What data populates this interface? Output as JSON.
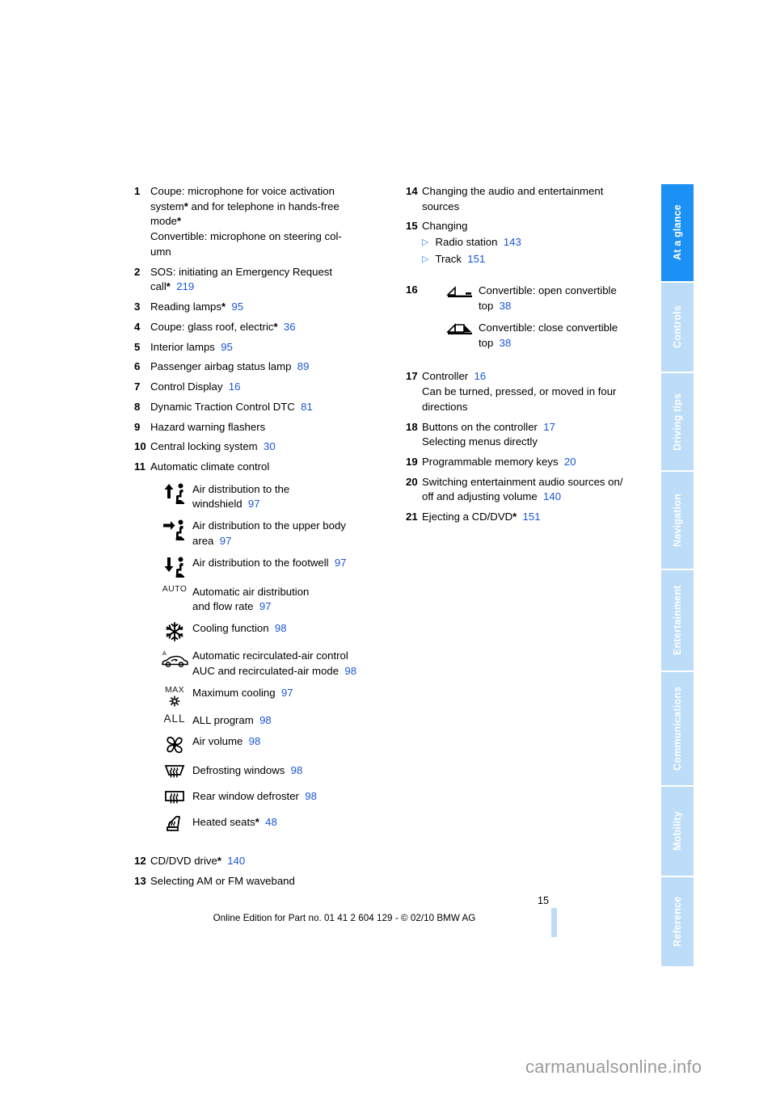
{
  "tabs": [
    {
      "label": "At a glance",
      "active": true
    },
    {
      "label": "Controls",
      "active": false
    },
    {
      "label": "Driving tips",
      "active": false
    },
    {
      "label": "Navigation",
      "active": false
    },
    {
      "label": "Entertainment",
      "active": false
    },
    {
      "label": "Communications",
      "active": false
    },
    {
      "label": "Mobility",
      "active": false
    },
    {
      "label": "Reference",
      "active": false
    }
  ],
  "colors": {
    "tab_active": "#1b90f5",
    "tab_inactive": "#bcdcf8",
    "page_link": "#1a56d6",
    "bullet": "#2f86f0"
  },
  "left": {
    "i1": {
      "num": "1",
      "l1": "Coupe: microphone for voice activation",
      "l2": "system",
      "l2b": " and for telephone in hands-free",
      "l3": "mode",
      "l4": "Convertible: microphone on steering col-",
      "l5": "umn"
    },
    "i2": {
      "num": "2",
      "l1": "SOS: initiating an Emergency Request",
      "l2": "call",
      "page": "219"
    },
    "i3": {
      "num": "3",
      "text": "Reading lamps",
      "page": "95"
    },
    "i4": {
      "num": "4",
      "text": "Coupe: glass roof, electric",
      "page": "36"
    },
    "i5": {
      "num": "5",
      "text": "Interior lamps",
      "page": "95"
    },
    "i6": {
      "num": "6",
      "text": "Passenger airbag status lamp",
      "page": "89"
    },
    "i7": {
      "num": "7",
      "text": "Control Display",
      "page": "16"
    },
    "i8": {
      "num": "8",
      "text": "Dynamic Traction Control DTC",
      "page": "81"
    },
    "i9": {
      "num": "9",
      "text": "Hazard warning flashers"
    },
    "i10": {
      "num": "10",
      "text": "Central locking system",
      "page": "30"
    },
    "i11": {
      "num": "11",
      "text": "Automatic climate control"
    },
    "i12": {
      "num": "12",
      "text": "CD/DVD drive",
      "page": "140"
    },
    "i13": {
      "num": "13",
      "text": "Selecting AM or FM waveband"
    }
  },
  "climate": [
    {
      "icon": "air-distribution-windshield-icon",
      "l1": "Air distribution to the",
      "l2": "windshield",
      "page": "97"
    },
    {
      "icon": "air-distribution-upper-body-icon",
      "l1": "Air distribution to the upper body",
      "l2": "area",
      "page": "97"
    },
    {
      "icon": "air-distribution-footwell-icon",
      "l1": "Air distribution to the footwell",
      "page": "97"
    },
    {
      "icon": "auto-icon",
      "icon_text": "AUTO",
      "l1": "Automatic air distribution",
      "l2": "and flow rate",
      "page": "97"
    },
    {
      "icon": "snowflake-cooling-icon",
      "l1": "Cooling function",
      "page": "98"
    },
    {
      "icon": "recirculated-air-car-icon",
      "l1": "Automatic recirculated-air control",
      "l2": "AUC and recirculated-air mode",
      "page": "98"
    },
    {
      "icon": "max-cooling-icon",
      "icon_text": "MAX",
      "l1": "Maximum cooling",
      "page": "97"
    },
    {
      "icon": "all-program-icon",
      "icon_text": "ALL",
      "l1": "ALL program",
      "page": "98"
    },
    {
      "icon": "fan-air-volume-icon",
      "l1": "Air volume",
      "page": "98"
    },
    {
      "icon": "windshield-defrost-icon",
      "l1": "Defrosting windows",
      "page": "98"
    },
    {
      "icon": "rear-window-defroster-icon",
      "l1": "Rear window defroster",
      "page": "98"
    },
    {
      "icon": "heated-seat-icon",
      "l1": "Heated seats",
      "asterisk": true,
      "page": "48"
    }
  ],
  "right": {
    "i14": {
      "num": "14",
      "l1": "Changing the audio and entertainment",
      "l2": "sources"
    },
    "i15": {
      "num": "15",
      "text": "Changing",
      "subs": [
        {
          "label": "Radio station",
          "page": "143"
        },
        {
          "label": "Track",
          "page": "151"
        }
      ]
    },
    "i16": {
      "num": "16",
      "icons": [
        {
          "icon": "convertible-top-open-icon",
          "l1": "Convertible: open convertible",
          "l2": "top",
          "page": "38"
        },
        {
          "icon": "convertible-top-close-icon",
          "l1": "Convertible: close convertible",
          "l2": "top",
          "page": "38"
        }
      ]
    },
    "i17": {
      "num": "17",
      "text": "Controller",
      "page": "16",
      "l2": "Can be turned, pressed, or moved in four",
      "l3": "directions"
    },
    "i18": {
      "num": "18",
      "text": "Buttons on the controller",
      "page": "17",
      "l2": "Selecting menus directly"
    },
    "i19": {
      "num": "19",
      "text": "Programmable memory keys",
      "page": "20"
    },
    "i20": {
      "num": "20",
      "l1": "Switching entertainment audio sources on/",
      "l2": "off and adjusting volume",
      "page": "140"
    },
    "i21": {
      "num": "21",
      "text": "Ejecting a CD/DVD",
      "page": "151"
    }
  },
  "footer": {
    "page_number": "15",
    "edition_line": "Online Edition for Part no. 01 41 2 604 129 - © 02/10 BMW AG"
  },
  "watermark": "carmanualsonline.info"
}
